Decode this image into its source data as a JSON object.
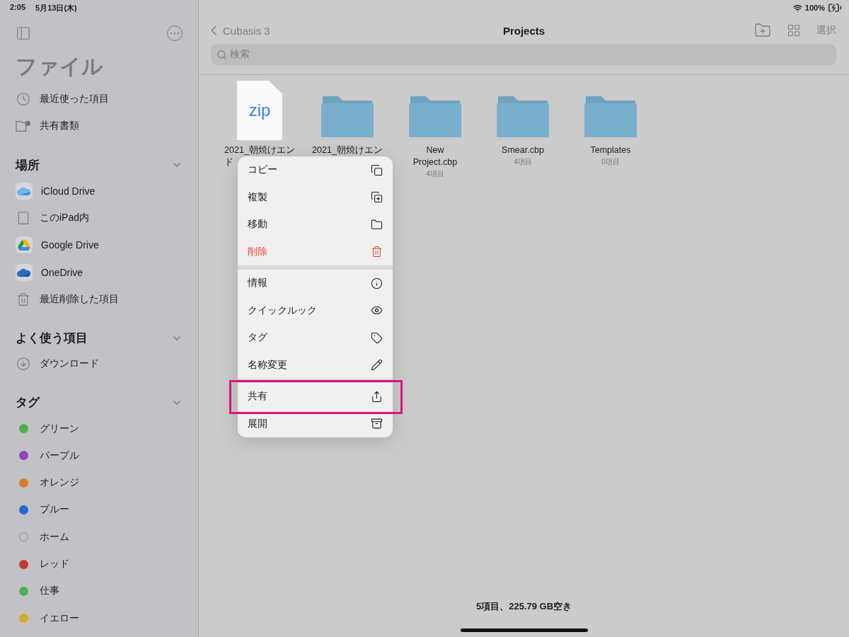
{
  "status_bar": {
    "time": "2:05",
    "date": "5月13日(木)",
    "battery": "100%"
  },
  "sidebar": {
    "title": "ファイル",
    "top_items": [
      {
        "label": "最近使った項目"
      },
      {
        "label": "共有書類"
      }
    ],
    "sections": [
      {
        "title": "場所",
        "expanded": true,
        "items": [
          {
            "label": "iCloud Drive"
          },
          {
            "label": "このiPad内"
          },
          {
            "label": "Google Drive"
          },
          {
            "label": "OneDrive"
          },
          {
            "label": "最近削除した項目"
          }
        ]
      },
      {
        "title": "よく使う項目",
        "expanded": true,
        "items": [
          {
            "label": "ダウンロード"
          }
        ]
      },
      {
        "title": "タグ",
        "expanded": true,
        "kind": "tags",
        "items": [
          {
            "label": "グリーン",
            "color": "#4caf50",
            "hollow": false
          },
          {
            "label": "パープル",
            "color": "#8e44c4",
            "hollow": false
          },
          {
            "label": "オレンジ",
            "color": "#d4822a",
            "hollow": false
          },
          {
            "label": "ブルー",
            "color": "#2767d4",
            "hollow": false
          },
          {
            "label": "ホーム",
            "color": "#8e8e93",
            "hollow": true
          },
          {
            "label": "レッド",
            "color": "#c8382e",
            "hollow": false
          },
          {
            "label": "仕事",
            "color": "#4caf50",
            "hollow": false
          },
          {
            "label": "イエロー",
            "color": "#d4ac2a",
            "hollow": false
          }
        ]
      }
    ]
  },
  "toolbar": {
    "back": "Cubasis 3",
    "title": "Projects",
    "select": "選択"
  },
  "search": {
    "placeholder": "検索"
  },
  "files": [
    {
      "kind": "zip",
      "badge": "zip",
      "name_lines": [
        "2021_朝焼けエン",
        "ド"
      ]
    },
    {
      "kind": "folder",
      "name_lines": [
        "2021_朝焼けエン"
      ]
    },
    {
      "kind": "folder",
      "name_lines": [
        "New",
        "Project.cbp"
      ],
      "count": "4項目"
    },
    {
      "kind": "folder",
      "name_lines": [
        "Smear.cbp"
      ],
      "count": "4項目"
    },
    {
      "kind": "folder",
      "name_lines": [
        "Templates"
      ],
      "count": "0項目"
    }
  ],
  "context_menu": {
    "sections": [
      [
        {
          "label": "コピー",
          "destructive": false,
          "highlighted": false
        },
        {
          "label": "複製",
          "destructive": false,
          "highlighted": false
        },
        {
          "label": "移動",
          "destructive": false,
          "highlighted": false
        },
        {
          "label": "削除",
          "destructive": true,
          "highlighted": false
        }
      ],
      [
        {
          "label": "情報",
          "destructive": false,
          "highlighted": false
        },
        {
          "label": "クイックルック",
          "destructive": false,
          "highlighted": false
        },
        {
          "label": "タグ",
          "destructive": false,
          "highlighted": false
        },
        {
          "label": "名称変更",
          "destructive": false,
          "highlighted": false
        }
      ],
      [
        {
          "label": "共有",
          "destructive": false,
          "highlighted": true
        },
        {
          "label": "展開",
          "destructive": false,
          "highlighted": false
        }
      ]
    ]
  },
  "footer": "5項目、225.79 GB空き"
}
